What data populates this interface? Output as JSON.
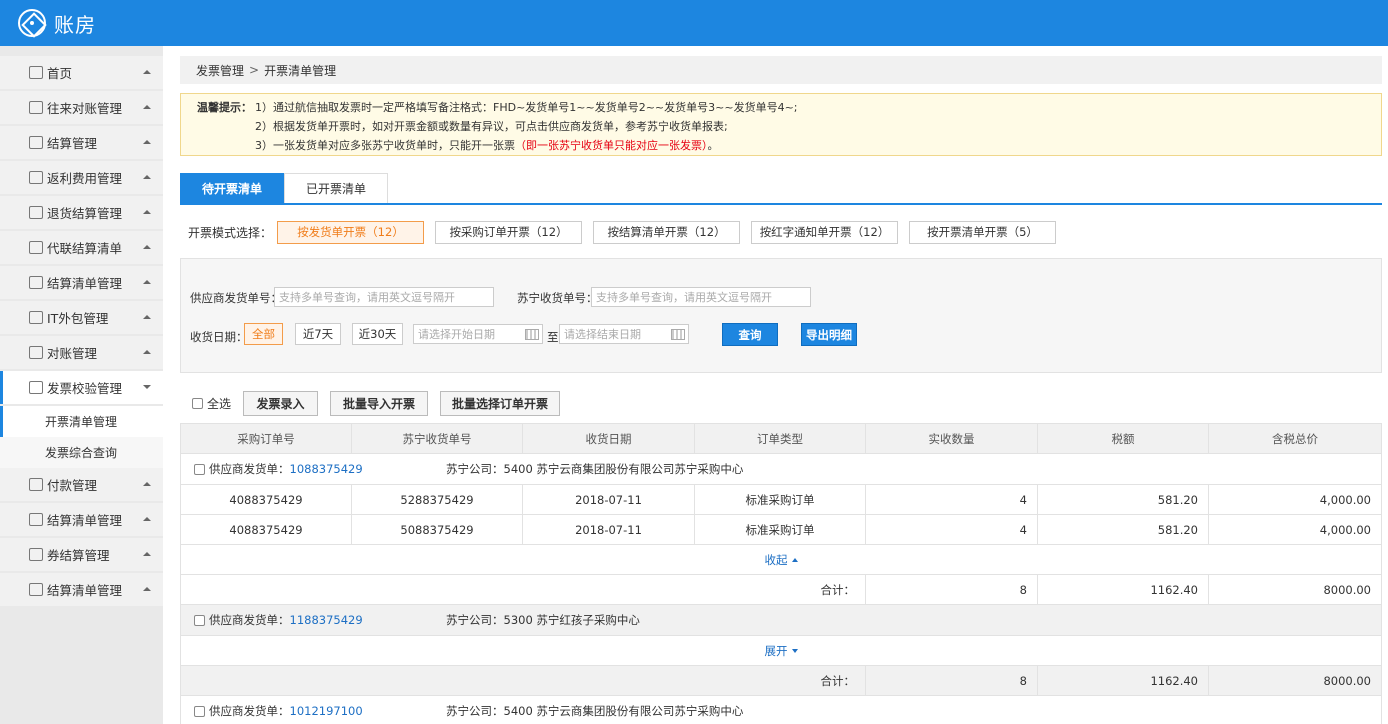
{
  "app": {
    "title": "账房"
  },
  "sidebar": {
    "items": [
      {
        "label": "首页"
      },
      {
        "label": "往来对账管理"
      },
      {
        "label": "结算管理"
      },
      {
        "label": "返利费用管理"
      },
      {
        "label": "退货结算管理"
      },
      {
        "label": "代联结算清单"
      },
      {
        "label": "结算清单管理"
      },
      {
        "label": "IT外包管理"
      },
      {
        "label": "对账管理"
      },
      {
        "label": "发票校验管理"
      },
      {
        "label": "付款管理"
      },
      {
        "label": "结算清单管理"
      },
      {
        "label": "券结算管理"
      },
      {
        "label": "结算清单管理"
      }
    ],
    "sub_items": [
      {
        "label": "开票清单管理"
      },
      {
        "label": "发票综合查询"
      }
    ]
  },
  "breadcrumb": {
    "parent": "发票管理",
    "sep": ">",
    "current": "开票清单管理"
  },
  "notice": {
    "title": "温馨提示：",
    "line1": "1）通过航信抽取发票时一定严格填写备注格式：FHD~发货单号1~~发货单号2~~发货单号3~~发货单号4~;",
    "line2": "2）根据发货单开票时，如对开票金额或数量有异议，可点击供应商发货单，参考苏宁收货单报表;",
    "line3_a": "3）一张发货单对应多张苏宁收货单时，只能开一张票",
    "line3_red": "（即一张苏宁收货单只能对应一张发票）",
    "line3_b": "。"
  },
  "tabs": [
    {
      "label": "待开票清单"
    },
    {
      "label": "已开票清单"
    }
  ],
  "modes": {
    "label": "开票模式选择：",
    "options": [
      {
        "label": "按发货单开票（12）"
      },
      {
        "label": "按采购订单开票（12）"
      },
      {
        "label": "按结算清单开票（12）"
      },
      {
        "label": "按红字通知单开票（12）"
      },
      {
        "label": "按开票清单开票（5）"
      }
    ]
  },
  "filter": {
    "supplier_label": "供应商发货单号：",
    "supplier_placeholder": "支持多单号查询，请用英文逗号隔开",
    "suning_label": "苏宁收货单号：",
    "suning_placeholder": "支持多单号查询，请用英文逗号隔开",
    "date_label": "收货日期：",
    "date_all": "全部",
    "date_7": "近7天",
    "date_30": "近30天",
    "start_placeholder": "请选择开始日期",
    "to": "至",
    "end_placeholder": "请选择结束日期",
    "search": "查询",
    "export": "导出明细"
  },
  "actions": {
    "select_all": "全选",
    "invoice_entry": "发票录入",
    "batch_import": "批量导入开票",
    "batch_select": "批量选择订单开票"
  },
  "table": {
    "headers": [
      "采购订单号",
      "苏宁收货单号",
      "收货日期",
      "订单类型",
      "实收数量",
      "税额",
      "含税总价"
    ],
    "groups": [
      {
        "prefix": "供应商发货单：",
        "delivery_no": "1088375429",
        "company": "苏宁公司：5400 苏宁云商集团股份有限公司苏宁采购中心",
        "rows": [
          [
            "4088375429",
            "5288375429",
            "2018-07-11",
            "标准采购订单",
            "4",
            "581.20",
            "4,000.00"
          ],
          [
            "4088375429",
            "5088375429",
            "2018-07-11",
            "标准采购订单",
            "4",
            "581.20",
            "4,000.00"
          ]
        ],
        "toggle": "收起",
        "total_label": "合计：",
        "total_qty": "8",
        "total_tax": "1162.40",
        "total_amount": "8000.00"
      },
      {
        "prefix": "供应商发货单：",
        "delivery_no": "1188375429",
        "company": "苏宁公司：5300 苏宁红孩子采购中心",
        "rows": [],
        "toggle": "展开",
        "total_label": "合计：",
        "total_qty": "8",
        "total_tax": "1162.40",
        "total_amount": "8000.00"
      },
      {
        "prefix": "供应商发货单：",
        "delivery_no": "1012197100",
        "company": "苏宁公司：5400 苏宁云商集团股份有限公司苏宁采购中心"
      }
    ]
  },
  "colors": {
    "primary": "#1d86e0",
    "accent": "#f07d1a",
    "warning_red": "#e60012"
  }
}
